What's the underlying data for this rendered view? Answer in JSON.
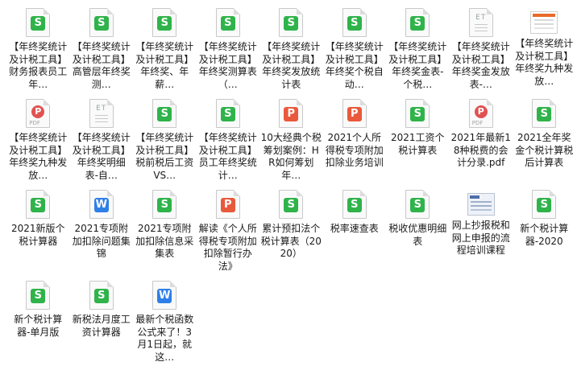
{
  "files": [
    {
      "label": "【年终奖统计及计税工具】财务报表员工年…",
      "icon": "sheet-icon",
      "type": "sheet",
      "glyph": "S"
    },
    {
      "label": "【年终奖统计及计税工具】高管层年终奖测…",
      "icon": "sheet-icon",
      "type": "sheet",
      "glyph": "S"
    },
    {
      "label": "【年终奖统计及计税工具】年终奖、年薪…",
      "icon": "sheet-icon",
      "type": "sheet",
      "glyph": "S"
    },
    {
      "label": "【年终奖统计及计税工具】年终奖测算表（…",
      "icon": "sheet-icon",
      "type": "sheet",
      "glyph": "S"
    },
    {
      "label": "【年终奖统计及计税工具】年终奖发放统计表",
      "icon": "sheet-icon",
      "type": "sheet",
      "glyph": "S"
    },
    {
      "label": "【年终奖统计及计税工具】年终奖个税自动…",
      "icon": "sheet-icon",
      "type": "sheet",
      "glyph": "S"
    },
    {
      "label": "【年终奖统计及计税工具】年终奖金表-个税…",
      "icon": "sheet-icon",
      "type": "sheet",
      "glyph": "S"
    },
    {
      "label": "【年终奖统计及计税工具】年终奖金发放表-…",
      "icon": "text-file-icon",
      "type": "text",
      "glyph": "ET"
    },
    {
      "label": "【年终奖统计及计税工具】年终奖九种发放…",
      "icon": "image-file-icon",
      "type": "image",
      "glyph": ""
    },
    {
      "label": "【年终奖统计及计税工具】年终奖九种发放…",
      "icon": "pdf-icon",
      "type": "pdf",
      "glyph": "P"
    },
    {
      "label": "【年终奖统计及计税工具】年终奖明细表-自…",
      "icon": "text-file-icon",
      "type": "text",
      "glyph": "ET"
    },
    {
      "label": "【年终奖统计及计税工具】税前税后工资VS…",
      "icon": "sheet-icon",
      "type": "sheet",
      "glyph": "S"
    },
    {
      "label": "【年终奖统计及计税工具】员工年终奖统计…",
      "icon": "sheet-icon",
      "type": "sheet",
      "glyph": "S"
    },
    {
      "label": "10大经典个税筹划案例：HR如何筹划年…",
      "icon": "presentation-icon",
      "type": "pres",
      "glyph": "P"
    },
    {
      "label": "2021个人所得税专项附加扣除业务培训",
      "icon": "presentation-icon",
      "type": "pres",
      "glyph": "P"
    },
    {
      "label": "2021工资个税计算表",
      "icon": "sheet-icon",
      "type": "sheet",
      "glyph": "S"
    },
    {
      "label": "2021年最新18种税费的会计分录.pdf",
      "icon": "pdf-icon",
      "type": "pdf",
      "glyph": "P"
    },
    {
      "label": "2021全年奖金个税计算税后计算表",
      "icon": "sheet-icon",
      "type": "sheet",
      "glyph": "S"
    },
    {
      "label": "2021新版个税计算器",
      "icon": "sheet-icon",
      "type": "sheet",
      "glyph": "S"
    },
    {
      "label": "2021专项附加扣除问题集锦",
      "icon": "word-icon",
      "type": "word",
      "glyph": "W"
    },
    {
      "label": "2021专项附加扣除信息采集表",
      "icon": "sheet-icon",
      "type": "sheet",
      "glyph": "S"
    },
    {
      "label": "解读《个人所得税专项附加扣除暂行办法》",
      "icon": "presentation-icon",
      "type": "pres",
      "glyph": "P"
    },
    {
      "label": "累计预扣法个税计算表（2020）",
      "icon": "sheet-icon",
      "type": "sheet",
      "glyph": "S"
    },
    {
      "label": "税率速查表",
      "icon": "sheet-icon",
      "type": "sheet",
      "glyph": "S"
    },
    {
      "label": "税收优惠明细表",
      "icon": "sheet-icon",
      "type": "sheet",
      "glyph": "S"
    },
    {
      "label": "网上抄报税和网上申报的流程培训课程",
      "icon": "screenshot-file-icon",
      "type": "scan",
      "glyph": ""
    },
    {
      "label": "新个税计算器-2020",
      "icon": "sheet-icon",
      "type": "sheet",
      "glyph": "S"
    },
    {
      "label": "新个税计算器-单月版",
      "icon": "sheet-icon",
      "type": "sheet",
      "glyph": "S"
    },
    {
      "label": "新税法月度工资计算器",
      "icon": "sheet-icon",
      "type": "sheet",
      "glyph": "S"
    },
    {
      "label": "最新个税函数公式来了！3月1日起，就这…",
      "icon": "word-icon",
      "type": "word",
      "glyph": "W"
    }
  ],
  "pdf_tag": "PDF"
}
